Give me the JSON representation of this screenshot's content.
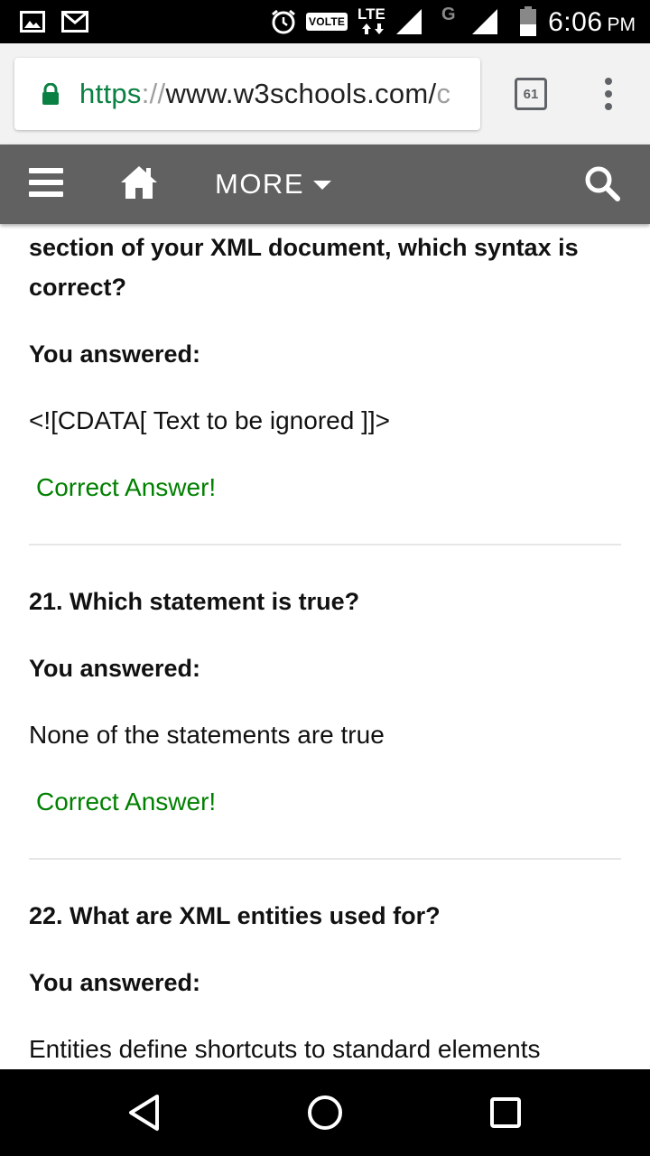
{
  "status_bar": {
    "volte_label": "VOLTE",
    "lte_label": "LTE",
    "g_label": "G",
    "time": "6:06",
    "ampm": "PM"
  },
  "browser": {
    "url_scheme": "https",
    "url_sep": "://",
    "url_host": "www.w3schools.com/",
    "url_rest": "c",
    "tab_count": "61"
  },
  "site_nav": {
    "more_label": "MORE"
  },
  "quiz": {
    "q20": {
      "text_partial": "section of your XML document, which syntax is correct?",
      "you_answered": "You answered:",
      "answer": "<![CDATA[ Text to be ignored ]]>",
      "result": "Correct Answer!"
    },
    "q21": {
      "text": "21. Which statement is true?",
      "you_answered": "You answered:",
      "answer": "None of the statements are true",
      "result": "Correct Answer!"
    },
    "q22": {
      "text": "22. What are XML entities used for?",
      "you_answered": "You answered:",
      "answer": "Entities define shortcuts to standard elements"
    }
  },
  "colors": {
    "correct_green": "#008000",
    "nav_gray": "#616161",
    "url_green": "#0b8043"
  }
}
